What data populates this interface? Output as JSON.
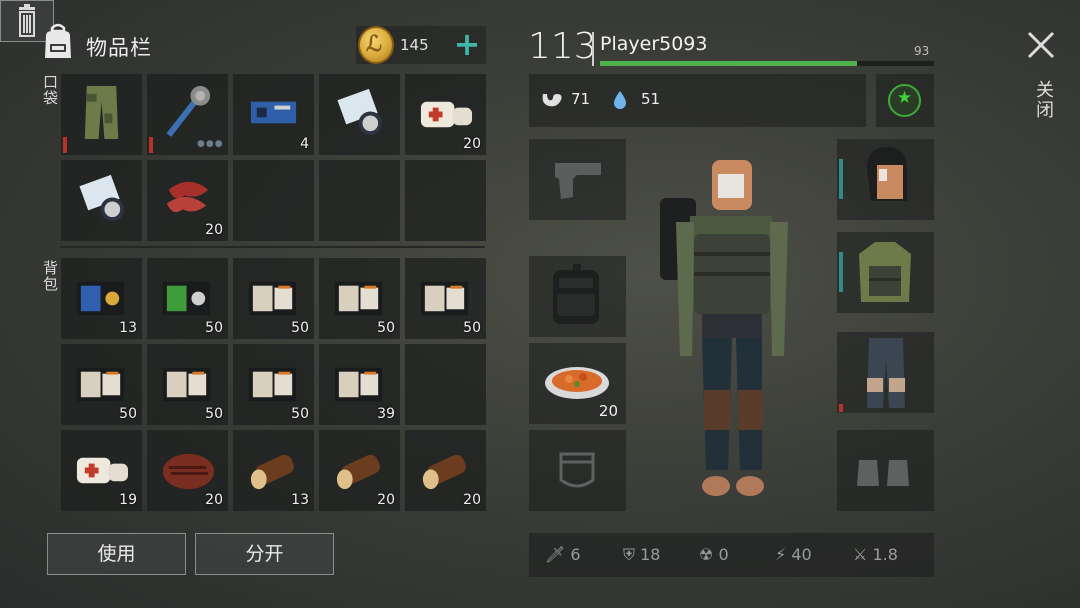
{
  "inventory": {
    "title": "物品栏",
    "coins": "145",
    "pocket_label": "口袋",
    "backpack_label": "背包",
    "pocket": [
      {
        "icon": "camo-pants-icon",
        "qty": ""
      },
      {
        "icon": "spiked-mace-icon",
        "qty": ""
      },
      {
        "icon": "circuit-board-icon",
        "qty": "4"
      },
      {
        "icon": "police-papers-icon",
        "qty": ""
      },
      {
        "icon": "bandage-icon",
        "qty": "20"
      },
      {
        "icon": "police-papers-icon",
        "qty": ""
      },
      {
        "icon": "raw-meat-icon",
        "qty": "20"
      },
      {
        "icon": "empty-slot",
        "qty": ""
      },
      {
        "icon": "empty-slot",
        "qty": ""
      },
      {
        "icon": "empty-slot",
        "qty": ""
      }
    ],
    "backpack": [
      {
        "icon": "police-badge-wallet-icon",
        "qty": "13"
      },
      {
        "icon": "green-id-wallet-icon",
        "qty": "50"
      },
      {
        "icon": "patrol-id-wallet-icon",
        "qty": "50"
      },
      {
        "icon": "patrol-id-wallet-icon",
        "qty": "50"
      },
      {
        "icon": "patrol-id-wallet-icon",
        "qty": "50"
      },
      {
        "icon": "patrol-id-wallet-icon",
        "qty": "50"
      },
      {
        "icon": "patrol-id-wallet-icon",
        "qty": "50"
      },
      {
        "icon": "patrol-id-wallet-icon",
        "qty": "50"
      },
      {
        "icon": "patrol-id-wallet-icon",
        "qty": "39"
      },
      {
        "icon": "empty-slot",
        "qty": ""
      },
      {
        "icon": "bandage-icon",
        "qty": "19"
      },
      {
        "icon": "steak-icon",
        "qty": "20"
      },
      {
        "icon": "log-icon",
        "qty": "13"
      },
      {
        "icon": "log-icon",
        "qty": "20"
      },
      {
        "icon": "log-icon",
        "qty": "20"
      }
    ],
    "use_label": "使用",
    "split_label": "分开"
  },
  "player": {
    "level": "113",
    "name": "Player5093",
    "hp": "93",
    "hp_fraction": 0.77,
    "hunger": "71",
    "thirst": "51"
  },
  "equipment": {
    "food_qty": "20"
  },
  "combat_stats": {
    "attack": "6",
    "defense": "18",
    "radiation": "0",
    "speed": "40",
    "attack_speed": "1.8"
  },
  "close_label": "关闭",
  "colors": {
    "accent_teal": "#3fb6a8",
    "hp_green": "#4fb34a",
    "durability_red": "#b8322a",
    "star_green": "#3fd13a"
  }
}
